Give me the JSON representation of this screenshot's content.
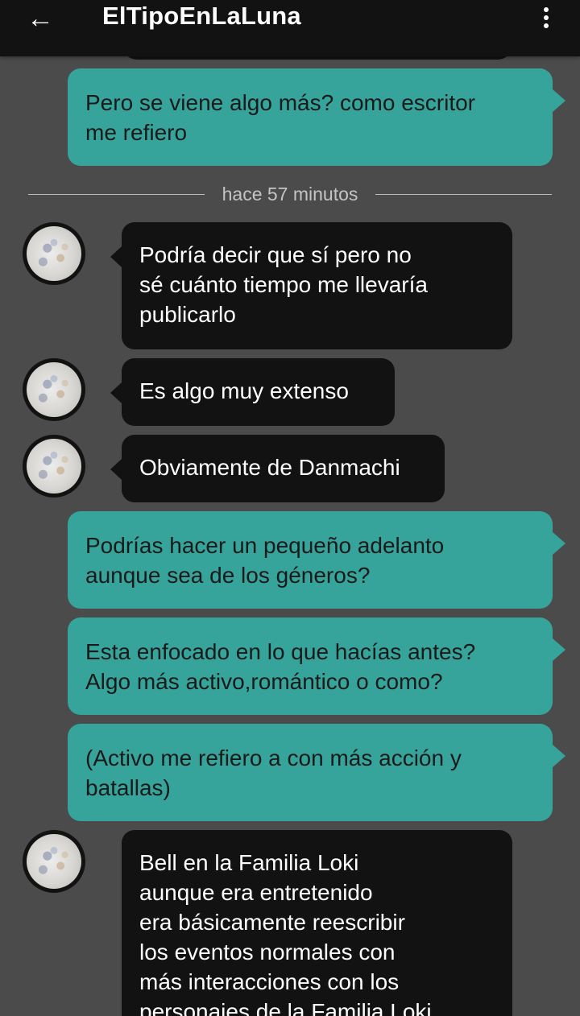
{
  "header": {
    "back_icon": "arrow-left-icon",
    "title": "ElTipoEnLaLuna",
    "menu_icon": "more-vertical-icon"
  },
  "divider": {
    "label": "hace 57 minutos"
  },
  "messages": [
    {
      "side": "out",
      "text": "Pero se viene algo más? como escritor\nme refiero"
    },
    {
      "side": "in",
      "text": "Podría decir que sí pero no\nsé cuánto tiempo me llevaría\npublicarlo"
    },
    {
      "side": "in",
      "text": "Es algo muy extenso"
    },
    {
      "side": "in",
      "text": "Obviamente de Danmachi"
    },
    {
      "side": "out",
      "text": "Podrías hacer un pequeño adelanto\naunque sea de los géneros?"
    },
    {
      "side": "out",
      "text": "Esta enfocado en lo que hacías antes?\nAlgo más activo,romántico o como?"
    },
    {
      "side": "out",
      "text": "(Activo me refiero a con más acción y\nbatallas)"
    },
    {
      "side": "in",
      "text": "Bell en la Familia Loki\naunque era entretenido\nera básicamente reescribir\nlos eventos normales con\nmás interacciones con los\npersonajes de la Familia Loki"
    }
  ],
  "colors": {
    "background": "#4b4b4b",
    "header": "#121212",
    "outgoing_bubble": "#36a49a",
    "incoming_bubble": "#121212"
  }
}
